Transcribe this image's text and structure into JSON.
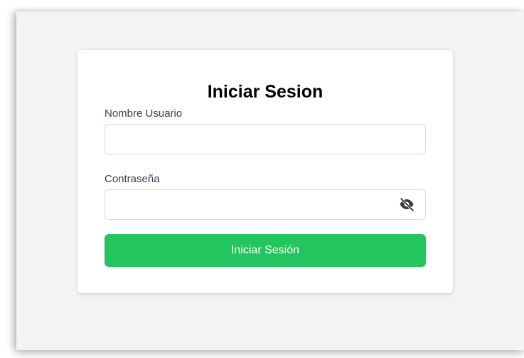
{
  "login": {
    "title": "Iniciar Sesion",
    "username_label": "Nombre Usuario",
    "username_value": "",
    "password_label": "Contraseña",
    "password_value": "",
    "toggle_icon": "eye-slash-icon",
    "submit_label": "Iniciar Sesión"
  },
  "colors": {
    "page_background": "#f2f3f5",
    "card_background": "#ffffff",
    "primary_button": "#22c55e",
    "button_text": "#ffffff",
    "label_text": "#374151",
    "title_text": "#000000",
    "input_border": "#d6d9de",
    "icon": "#3a3a3a"
  }
}
